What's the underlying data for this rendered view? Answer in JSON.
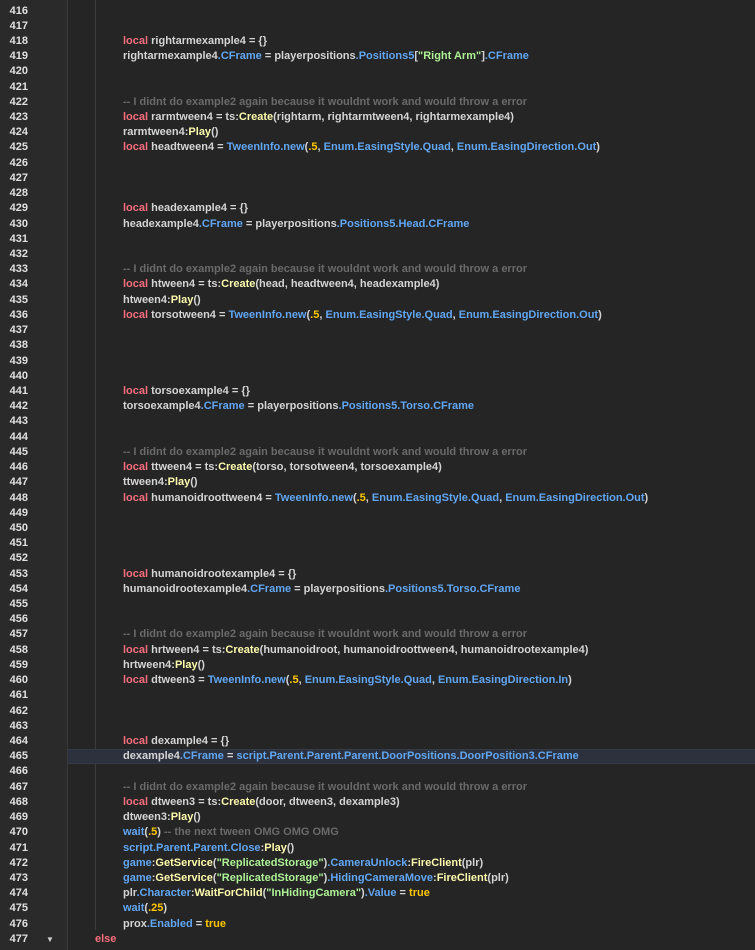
{
  "editor": {
    "fold_icon": "chevron-down-icon",
    "highlighted_line": 465,
    "colors": {
      "keyword": "#f86d7c",
      "builtin": "#61a6f2",
      "method": "#fdfbac",
      "string": "#adf195",
      "number": "#ffc600",
      "comment": "#6a6a6a",
      "text": "#d4d4d4",
      "background": "#252525"
    },
    "lines": [
      {
        "n": "416",
        "i": 0,
        "t": []
      },
      {
        "n": "417",
        "i": 0,
        "t": []
      },
      {
        "n": "418",
        "i": 2,
        "t": [
          "k:local",
          "t: rightarmexample4 = {}"
        ]
      },
      {
        "n": "419",
        "i": 2,
        "t": [
          "t:rightarmexample4",
          "p:.CFrame",
          "t: = playerpositions",
          "p:.Positions5",
          "t:[",
          "s:\"Right Arm\"",
          "t:]",
          "p:.CFrame"
        ]
      },
      {
        "n": "420",
        "i": 0,
        "t": []
      },
      {
        "n": "421",
        "i": 0,
        "t": []
      },
      {
        "n": "422",
        "i": 2,
        "t": [
          "c:-- I didnt do example2 again because it wouldnt work and would throw a error"
        ]
      },
      {
        "n": "423",
        "i": 2,
        "t": [
          "k:local",
          "t: rarmtween4 = ts:",
          "m:Create",
          "t:(rightarm, rightarmtween4, rightarmexample4)"
        ]
      },
      {
        "n": "424",
        "i": 2,
        "t": [
          "t:rarmtween4:",
          "m:Play",
          "t:()"
        ]
      },
      {
        "n": "425",
        "i": 2,
        "t": [
          "k:local",
          "t: headtween4 = ",
          "p:TweenInfo.new",
          "t:(",
          "n:.5",
          "t:, ",
          "p:Enum.EasingStyle.Quad",
          "t:, ",
          "p:Enum.EasingDirection.Out",
          "t:)"
        ]
      },
      {
        "n": "426",
        "i": 0,
        "t": []
      },
      {
        "n": "427",
        "i": 0,
        "t": []
      },
      {
        "n": "428",
        "i": 0,
        "t": []
      },
      {
        "n": "429",
        "i": 2,
        "t": [
          "k:local",
          "t: headexample4 = {}"
        ]
      },
      {
        "n": "430",
        "i": 2,
        "t": [
          "t:headexample4",
          "p:.CFrame",
          "t: = playerpositions",
          "p:.Positions5.Head.CFrame"
        ]
      },
      {
        "n": "431",
        "i": 0,
        "t": []
      },
      {
        "n": "432",
        "i": 0,
        "t": []
      },
      {
        "n": "433",
        "i": 2,
        "t": [
          "c:-- I didnt do example2 again because it wouldnt work and would throw a error"
        ]
      },
      {
        "n": "434",
        "i": 2,
        "t": [
          "k:local",
          "t: htween4 = ts:",
          "m:Create",
          "t:(head, headtween4, headexample4)"
        ]
      },
      {
        "n": "435",
        "i": 2,
        "t": [
          "t:htween4:",
          "m:Play",
          "t:()"
        ]
      },
      {
        "n": "436",
        "i": 2,
        "t": [
          "k:local",
          "t: torsotween4 = ",
          "p:TweenInfo.new",
          "t:(",
          "n:.5",
          "t:, ",
          "p:Enum.EasingStyle.Quad",
          "t:, ",
          "p:Enum.EasingDirection.Out",
          "t:)"
        ]
      },
      {
        "n": "437",
        "i": 0,
        "t": []
      },
      {
        "n": "438",
        "i": 0,
        "t": []
      },
      {
        "n": "439",
        "i": 0,
        "t": []
      },
      {
        "n": "440",
        "i": 0,
        "t": []
      },
      {
        "n": "441",
        "i": 2,
        "t": [
          "k:local",
          "t: torsoexample4 = {}"
        ]
      },
      {
        "n": "442",
        "i": 2,
        "t": [
          "t:torsoexample4",
          "p:.CFrame",
          "t: = playerpositions",
          "p:.Positions5.Torso.CFrame"
        ]
      },
      {
        "n": "443",
        "i": 0,
        "t": []
      },
      {
        "n": "444",
        "i": 0,
        "t": []
      },
      {
        "n": "445",
        "i": 2,
        "t": [
          "c:-- I didnt do example2 again because it wouldnt work and would throw a error"
        ]
      },
      {
        "n": "446",
        "i": 2,
        "t": [
          "k:local",
          "t: ttween4 = ts:",
          "m:Create",
          "t:(torso, torsotween4, torsoexample4)"
        ]
      },
      {
        "n": "447",
        "i": 2,
        "t": [
          "t:ttween4:",
          "m:Play",
          "t:()"
        ]
      },
      {
        "n": "448",
        "i": 2,
        "t": [
          "k:local",
          "t: humanoidroottween4 = ",
          "p:TweenInfo.new",
          "t:(",
          "n:.5",
          "t:, ",
          "p:Enum.EasingStyle.Quad",
          "t:, ",
          "p:Enum.EasingDirection.Out",
          "t:)"
        ]
      },
      {
        "n": "449",
        "i": 0,
        "t": []
      },
      {
        "n": "450",
        "i": 0,
        "t": []
      },
      {
        "n": "451",
        "i": 0,
        "t": []
      },
      {
        "n": "452",
        "i": 0,
        "t": []
      },
      {
        "n": "453",
        "i": 2,
        "t": [
          "k:local",
          "t: humanoidrootexample4 = {}"
        ]
      },
      {
        "n": "454",
        "i": 2,
        "t": [
          "t:humanoidrootexample4",
          "p:.CFrame",
          "t: = playerpositions",
          "p:.Positions5.Torso.CFrame"
        ]
      },
      {
        "n": "455",
        "i": 0,
        "t": []
      },
      {
        "n": "456",
        "i": 0,
        "t": []
      },
      {
        "n": "457",
        "i": 2,
        "t": [
          "c:-- I didnt do example2 again because it wouldnt work and would throw a error"
        ]
      },
      {
        "n": "458",
        "i": 2,
        "t": [
          "k:local",
          "t: hrtween4 = ts:",
          "m:Create",
          "t:(humanoidroot, humanoidroottween4, humanoidrootexample4)"
        ]
      },
      {
        "n": "459",
        "i": 2,
        "t": [
          "t:hrtween4:",
          "m:Play",
          "t:()"
        ]
      },
      {
        "n": "460",
        "i": 2,
        "t": [
          "k:local",
          "t: dtween3 = ",
          "p:TweenInfo.new",
          "t:(",
          "n:.5",
          "t:, ",
          "p:Enum.EasingStyle.Quad",
          "t:, ",
          "p:Enum.EasingDirection.In",
          "t:)"
        ]
      },
      {
        "n": "461",
        "i": 0,
        "t": []
      },
      {
        "n": "462",
        "i": 0,
        "t": []
      },
      {
        "n": "463",
        "i": 0,
        "t": []
      },
      {
        "n": "464",
        "i": 2,
        "t": [
          "k:local",
          "t: dexample4 = {}"
        ]
      },
      {
        "n": "465",
        "i": 2,
        "t": [
          "t:dexample4",
          "p:.CFrame",
          "t: = ",
          "p:script.Parent.Parent.Parent.DoorPositions.DoorPosition3.CFrame"
        ]
      },
      {
        "n": "466",
        "i": 0,
        "t": []
      },
      {
        "n": "467",
        "i": 2,
        "t": [
          "c:-- I didnt do example2 again because it wouldnt work and would throw a error"
        ]
      },
      {
        "n": "468",
        "i": 2,
        "t": [
          "k:local",
          "t: dtween3 = ts:",
          "m:Create",
          "t:(door, dtween3, dexample3)"
        ]
      },
      {
        "n": "469",
        "i": 2,
        "t": [
          "t:dtween3:",
          "m:Play",
          "t:()"
        ]
      },
      {
        "n": "470",
        "i": 2,
        "t": [
          "p:wait",
          "t:(",
          "n:.5",
          "t:) ",
          "c:-- the next tween OMG OMG OMG"
        ]
      },
      {
        "n": "471",
        "i": 2,
        "t": [
          "p:script.Parent.Parent.Close",
          "t::",
          "m:Play",
          "t:()"
        ]
      },
      {
        "n": "472",
        "i": 2,
        "t": [
          "p:game",
          "t::",
          "m:GetService",
          "t:(",
          "s:\"ReplicatedStorage\"",
          "t:)",
          "p:.CameraUnlock",
          "t::",
          "m:FireClient",
          "t:(plr)"
        ]
      },
      {
        "n": "473",
        "i": 2,
        "t": [
          "p:game",
          "t::",
          "m:GetService",
          "t:(",
          "s:\"ReplicatedStorage\"",
          "t:)",
          "p:.HidingCameraMove",
          "t::",
          "m:FireClient",
          "t:(plr)"
        ]
      },
      {
        "n": "474",
        "i": 2,
        "t": [
          "t:plr",
          "p:.Character",
          "t::",
          "m:WaitForChild",
          "t:(",
          "s:\"InHidingCamera\"",
          "t:)",
          "p:.Value",
          "t: = ",
          "n:true"
        ]
      },
      {
        "n": "475",
        "i": 2,
        "t": [
          "p:wait",
          "t:(",
          "n:.25",
          "t:)"
        ]
      },
      {
        "n": "476",
        "i": 2,
        "t": [
          "t:prox",
          "p:.Enabled",
          "t: = ",
          "n:true"
        ]
      },
      {
        "n": "477",
        "i": 1,
        "t": [
          "k:else"
        ],
        "fold": true
      }
    ]
  }
}
